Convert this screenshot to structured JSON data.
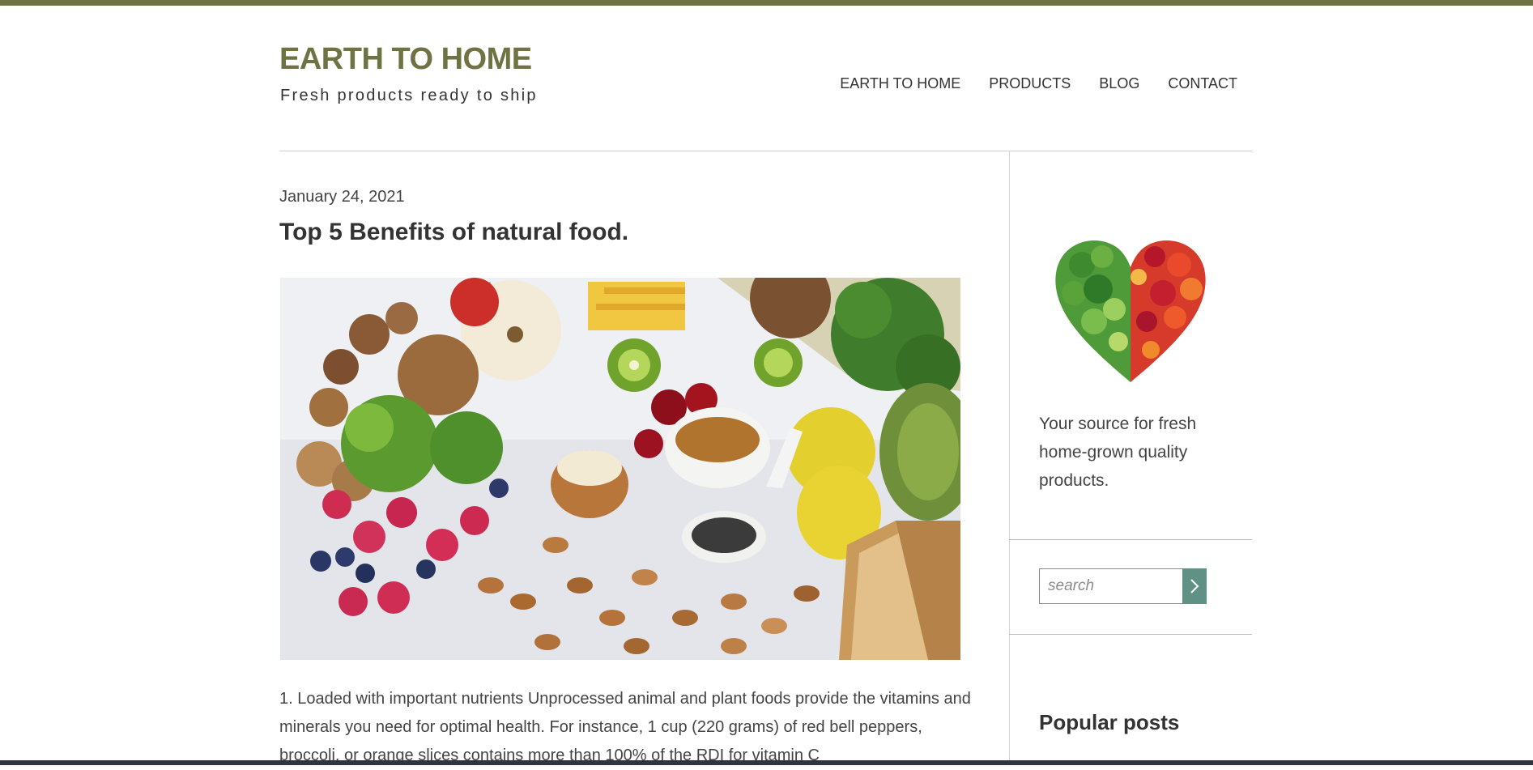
{
  "colors": {
    "accent": "#6f7344",
    "search_button": "#5f9185"
  },
  "header": {
    "site_title": "EARTH TO HOME",
    "tagline": "Fresh products ready to ship",
    "nav": [
      "EARTH TO HOME",
      "PRODUCTS",
      "BLOG",
      "CONTACT"
    ]
  },
  "post": {
    "date": "January 24, 2021",
    "title": "Top 5 Benefits of natural food.",
    "image_icon": "fruits-vegetables-nuts-photo",
    "body": "1. Loaded with important nutrients Unprocessed animal and plant foods provide the vitamins and minerals you need for optimal health. For instance, 1 cup (220 grams) of red bell peppers, broccoli, or orange slices contains more than 100% of the RDI for vitamin C"
  },
  "sidebar": {
    "image_icon": "vegetable-heart-image",
    "about": "Your source for fresh home-grown quality products.",
    "search": {
      "placeholder": "search",
      "button_icon": "chevron-right-icon"
    },
    "popular_heading": "Popular posts"
  }
}
